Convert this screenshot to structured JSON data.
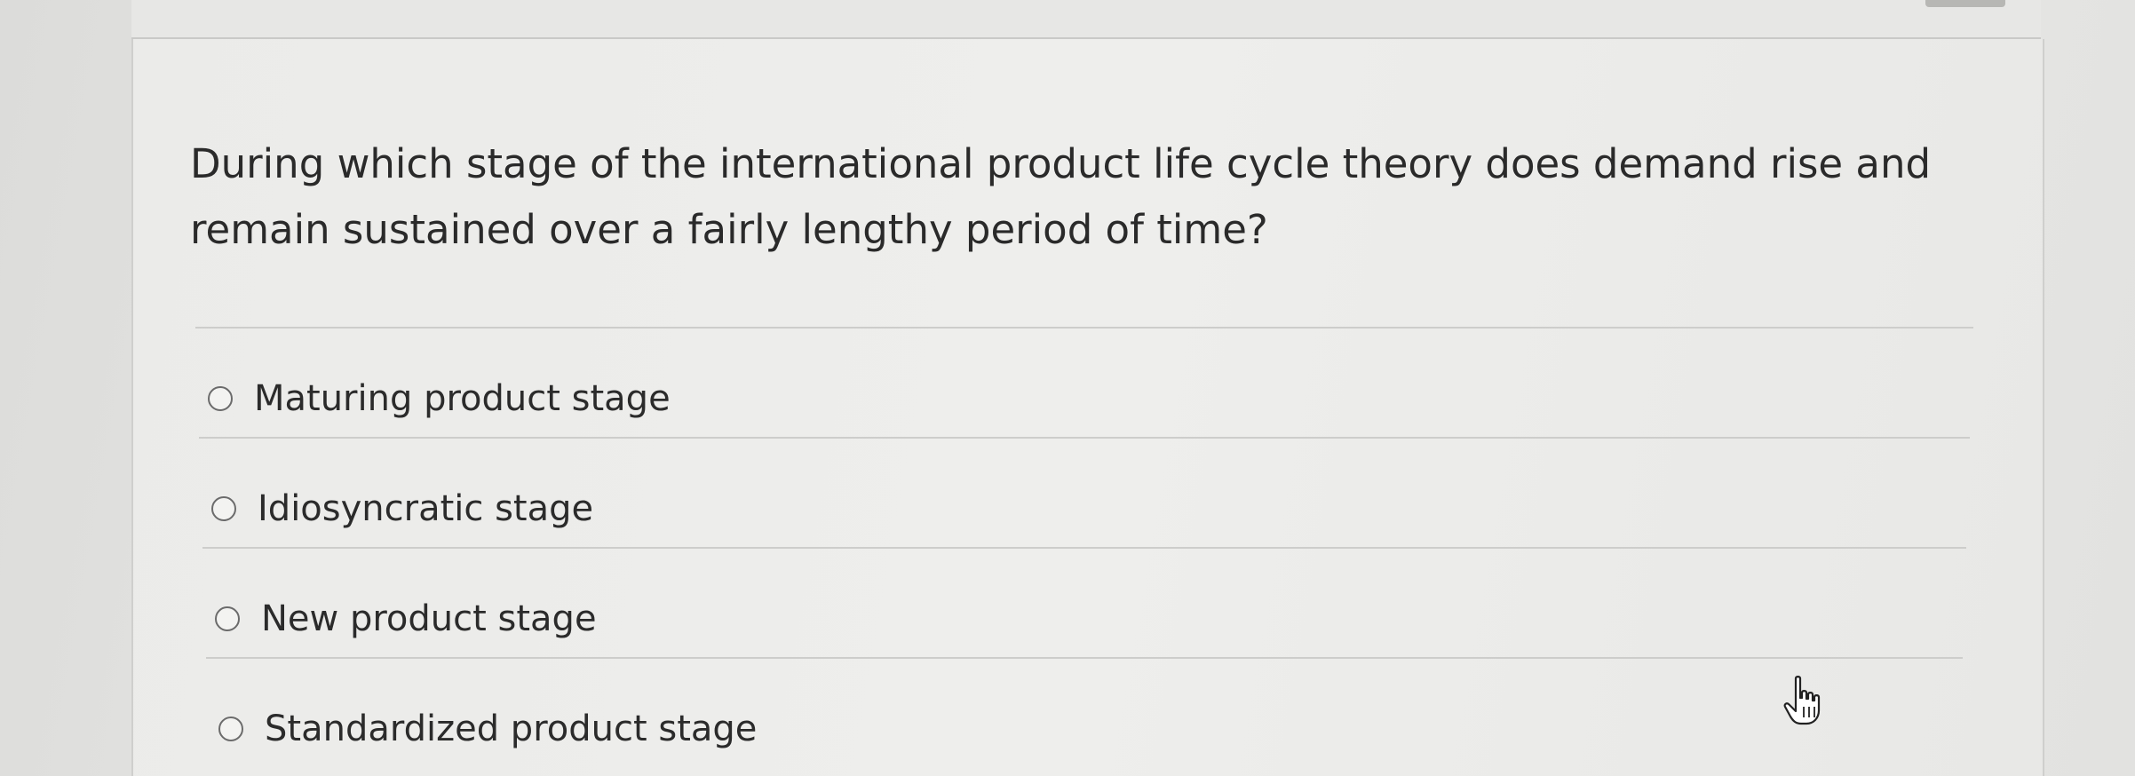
{
  "question": {
    "text": "During which stage of the international product life cycle theory does demand rise and remain sustained over a fairly lengthy period of time?"
  },
  "options": [
    {
      "label": "Maturing product stage",
      "selected": false
    },
    {
      "label": "Idiosyncratic stage",
      "selected": false
    },
    {
      "label": "New product stage",
      "selected": false
    },
    {
      "label": "Standardized product stage",
      "selected": false
    }
  ],
  "icons": {
    "radio": "radio-button-icon",
    "cursor": "hand-pointer-icon"
  }
}
